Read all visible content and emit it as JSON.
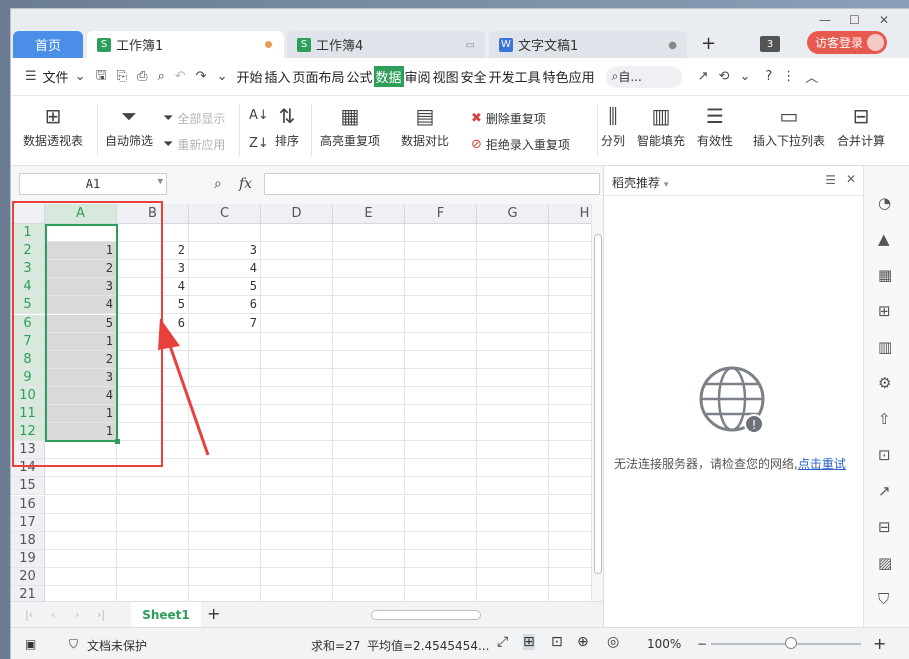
{
  "tabs": {
    "home": "首页",
    "doc1": "工作簿1",
    "doc2": "工作簿4",
    "doc3": "文字文稿1",
    "window_count": "3",
    "visitor_login": "访客登录"
  },
  "menu": {
    "file": "文件",
    "items": [
      "开始",
      "插入",
      "页面布局",
      "公式",
      "数据",
      "审阅",
      "视图",
      "安全",
      "开发工具",
      "特色应用"
    ],
    "active": "数据",
    "search_placeholder": "自..."
  },
  "ribbon": {
    "pivot": "数据透视表",
    "autofilter": "自动筛选",
    "show_all": "全部显示",
    "reapply": "重新应用",
    "sort": "排序",
    "highlight_dup": "高亮重复项",
    "data_compare": "数据对比",
    "delete_dup": "删除重复项",
    "reject_dup": "拒绝录入重复项",
    "split_col": "分列",
    "smart_fill": "智能填充",
    "validity": "有效性",
    "insert_dropdown": "插入下拉列表",
    "merge_calc": "合并计算"
  },
  "formula": {
    "name_box": "A1",
    "fx": "fx",
    "value": ""
  },
  "sheet": {
    "columns": [
      "A",
      "B",
      "C",
      "D",
      "E",
      "F",
      "G",
      "H"
    ],
    "rows": [
      "1",
      "2",
      "3",
      "4",
      "5",
      "6",
      "7",
      "8",
      "9",
      "10",
      "11",
      "12",
      "13",
      "14",
      "15",
      "16",
      "17",
      "18",
      "19",
      "20",
      "21"
    ],
    "col_a": [
      "",
      "1",
      "2",
      "3",
      "4",
      "5",
      "1",
      "2",
      "3",
      "4",
      "1",
      "1"
    ],
    "col_b": [
      "",
      "2",
      "3",
      "4",
      "5",
      "6"
    ],
    "col_c": [
      "",
      "3",
      "4",
      "5",
      "6",
      "7"
    ],
    "tab": "Sheet1"
  },
  "status": {
    "doc_protect": "文档未保护",
    "sum": "求和=27",
    "avg": "平均值=2.4545454...",
    "zoom": "100%"
  },
  "panel": {
    "title": "稻壳推荐",
    "message": "无法连接服务器，请检查您的网络,",
    "retry": "点击重试"
  },
  "colors": {
    "accent_green": "#2e9e5b",
    "home_blue": "#4a8ee8",
    "annotation_red": "#e8403a"
  }
}
